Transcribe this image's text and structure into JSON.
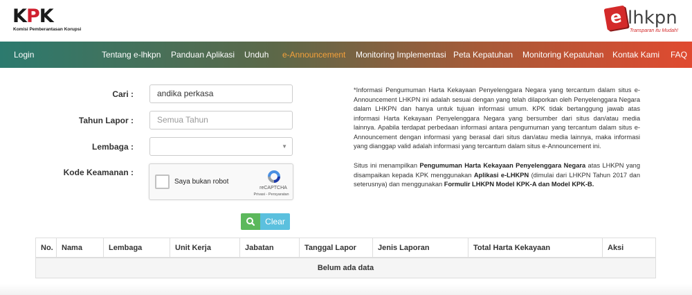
{
  "header": {
    "brand_logo_text": "KPK",
    "brand_subtitle": "Komisi Pemberantasan Korupsi",
    "app_logo_text": "lhkpn",
    "app_logo_tagline": "Transparan itu Mudah!"
  },
  "nav": {
    "login": "Login",
    "items": [
      {
        "label": "Tentang e-lhkpn"
      },
      {
        "label": "Panduan Aplikasi"
      },
      {
        "label": "Unduh"
      },
      {
        "label": "e-Announcement"
      },
      {
        "label": "Monitoring Implementasi"
      },
      {
        "label": "Peta Kepatuhan"
      },
      {
        "label": "Monitoring Kepatuhan"
      },
      {
        "label": "Kontak Kami"
      },
      {
        "label": "FAQ"
      }
    ],
    "active": "e-Announcement",
    "active_color": "#f5a13a"
  },
  "form": {
    "cari_label": "Cari :",
    "cari_value": "andika perkasa",
    "tahun_label": "Tahun Lapor :",
    "tahun_placeholder": "Semua Tahun",
    "lembaga_label": "Lembaga :",
    "lembaga_value": "",
    "kode_label": "Kode Keamanan :",
    "captcha_label": "Saya bukan robot",
    "captcha_brand": "reCAPTCHA",
    "captcha_links": "Privasi - Persyaratan",
    "search_icon": "search-icon",
    "clear_label": "Clear"
  },
  "info": {
    "p1": "*Informasi Pengumuman Harta Kekayaan Penyelenggara Negara yang tercantum dalam situs e-Announcement LHKPN ini adalah sesuai dengan yang telah dilaporkan oleh Penyelenggara Negara dalam LHKPN dan hanya untuk tujuan informasi umum. KPK tidak bertanggung jawab atas informasi Harta Kekayaan Penyelenggara Negara yang bersumber dari situs dan/atau media lainnya. Apabila terdapat perbedaan informasi antara pengumuman yang tercantum dalam situs e-Announcement dengan informasi yang berasal dari situs dan/atau media lainnya, maka informasi yang dianggap valid adalah informasi yang tercantum dalam situs e-Announcement ini.",
    "p2_a": "Situs ini menampilkan ",
    "p2_b": "Pengumuman Harta Kekayaan Penyelenggara Negara",
    "p2_c": " atas LHKPN yang disampaikan kepada KPK menggunakan ",
    "p2_d": "Aplikasi e-LHKPN",
    "p2_e": " (dimulai dari LHKPN Tahun 2017 dan seterusnya) dan menggunakan ",
    "p2_f": "Formulir LHKPN Model KPK-A dan Model KPK-B."
  },
  "table": {
    "columns": [
      "No.",
      "Nama",
      "Lembaga",
      "Unit Kerja",
      "Jabatan",
      "Tanggal Lapor",
      "Jenis Laporan",
      "Total Harta Kekayaan",
      "Aksi"
    ],
    "empty_text": "Belum ada data"
  },
  "colors": {
    "brand_red": "#d0202f",
    "nav_gradient_start": "#2c7a6e",
    "nav_gradient_end": "#e04a30",
    "search_button": "#5cb85c",
    "clear_button": "#5bc0de"
  }
}
